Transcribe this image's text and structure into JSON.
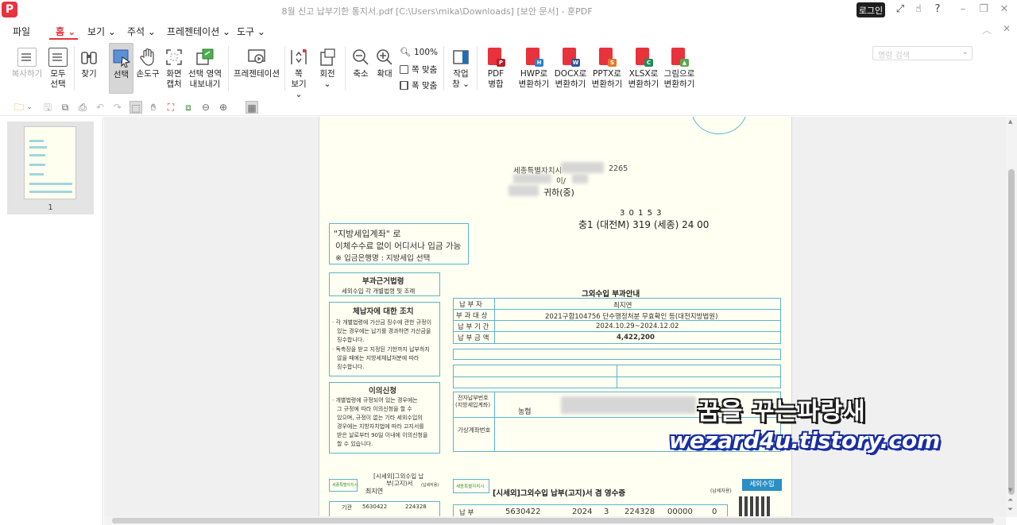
{
  "window": {
    "title": "8월 신고 납부기한 통지서.pdf [C:\\Users\\mika\\Downloads] [보안 문서] - 훈PDF",
    "login_label": "로그인",
    "logo_letter": "P"
  },
  "menu": {
    "items": [
      {
        "label": "파일"
      },
      {
        "label": "홈 ⌄"
      },
      {
        "label": "보기 ⌄"
      },
      {
        "label": "주석 ⌄"
      },
      {
        "label": "프레젠테이션 ⌄"
      },
      {
        "label": "도구 ⌄"
      }
    ],
    "search_placeholder": "명령 검색"
  },
  "ribbon": {
    "copy": "복사하기",
    "select_all_1": "모두",
    "select_all_2": "선택",
    "find": "찾기",
    "select": "선택",
    "hand": "손도구",
    "capture_1": "화면",
    "capture_2": "캡처",
    "export_area_1": "선택 영역",
    "export_area_2": "내보내기",
    "presentation": "프레젠테이션",
    "fit_view_1": "쪽",
    "fit_view_2": "보기 ⌄",
    "rotate_1": "회전",
    "rotate_2": "⌄",
    "zoom_out": "축소",
    "zoom_in": "확대",
    "zoom_100": "100%",
    "fit_page": "쪽 맞춤",
    "fit_width": "폭 맞춤",
    "work_window_1": "작업",
    "work_window_2": "창 ⌄",
    "pdf_merge_1": "PDF",
    "pdf_merge_2": "병합",
    "to_hwp_1": "HWP로",
    "to_hwp_2": "변환하기",
    "to_docx_1": "DOCX로",
    "to_docx_2": "변환하기",
    "to_pptx_1": "PPTX로",
    "to_pptx_2": "변환하기",
    "to_xlsx_1": "XLSX로",
    "to_xlsx_2": "변환하기",
    "to_image_1": "그림으로",
    "to_image_2": "변환하기"
  },
  "thumbnail": {
    "page_number": "1"
  },
  "document": {
    "addr_city": "세종특별자치시",
    "addr_code": "2265",
    "addr_unit": "이/",
    "addressee": "귀하(중)",
    "zip": "3 0 1 5 3",
    "route": "충1 (대전M) 319 (세종) 24 00",
    "promo_1": "\"지방세입계좌\" 로",
    "promo_2": "이체수수료 없이 어디서나 입금 가능",
    "promo_3": "※ 입금은행명 : 지방세입 선택",
    "law_title": "부과근거법령",
    "law_body": "세외수입 각 개별법령 및 조례",
    "arrears_title": "체납자에 대한 조치",
    "arrears_body_1": "· 각 개별법령에 가산금 징수에 관한 규정이",
    "arrears_body_2": "있는 경우에는 납기를 경과하면 가산금을",
    "arrears_body_3": "징수합니다.",
    "arrears_body_4": "· 독촉장을 받고 지정된 기한까지 납부하지",
    "arrears_body_5": "않을 때에는 지방세체납처분에 따라",
    "arrears_body_6": "징수합니다.",
    "objection_title": "이의신청",
    "objection_body_1": "· 개별법령에 규정되어 있는 경우에는",
    "objection_body_2": "그 규정에 따라 이의신청을 할 수",
    "objection_body_3": "있으며, 규정이 없는 기타 세외수입의",
    "objection_body_4": "경우에는 지방자치법에 따라 고지서를",
    "objection_body_5": "받은 날로부터 90일 이내에 이의신청을",
    "objection_body_6": "할 수 있습니다.",
    "notice_title": "그외수입 부과안내",
    "r1_label": "납 부 자",
    "r1_value": "최지연",
    "r2_label": "부 과 대 상",
    "r2_value": "2021구합104756 단수행정처분 무효확인 등(대전지방법원)",
    "r3_label": "납 부 기 간",
    "r3_value": "2024.10.29~2024.12.02",
    "r4_label": "납 부 금 액",
    "r4_value": "4,422,200",
    "acct_label_1": "전자납부번호",
    "acct_label_2": "(지방세입계좌)",
    "bank": "농협",
    "virtual_acct": "가상계좌번호",
    "receipt_title_small": "[시세외]그외수입 납",
    "receipt_title_small_2": "부(고지)서",
    "receipt_title": "[시세외]그외수입 납부(고지)서 겸 영수증",
    "receipt_name": "최지연",
    "receipt_badge": "세외수입",
    "receipt_tag": "(납세자용)",
    "city_logo": "세종특별자치시",
    "left_row_label": "기관",
    "left_row_code": "5630422",
    "left_row_num": "224328",
    "bottom_label": "납 부",
    "bottom_n1": "5630422",
    "bottom_n2": "2024",
    "bottom_n3": "3",
    "bottom_n4": "224328",
    "bottom_n5": "00000",
    "bottom_n6": "0"
  },
  "watermark": {
    "line1": "꿈을 꾸는파랑새",
    "line2": "wezard4u.tistory.com"
  },
  "colors": {
    "accent": "#e8323c",
    "form_cyan": "#5ab5cc"
  }
}
